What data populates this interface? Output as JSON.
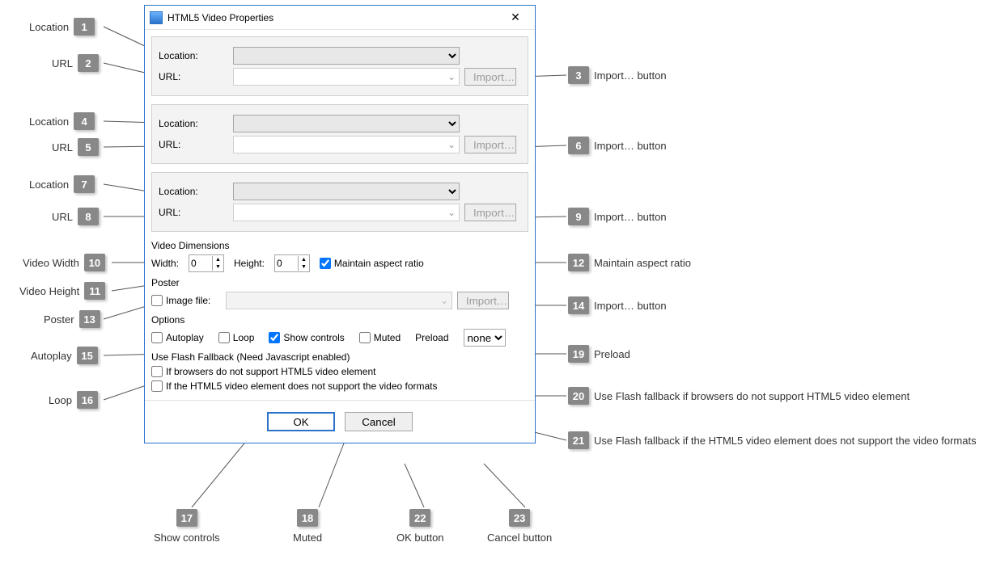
{
  "dialog": {
    "title": "HTML5 Video Properties",
    "close_icon": "✕"
  },
  "sources": [
    {
      "location_label": "Location:",
      "url_label": "URL:",
      "location_value": "",
      "url_value": "",
      "import_label": "Import…"
    },
    {
      "location_label": "Location:",
      "url_label": "URL:",
      "location_value": "",
      "url_value": "",
      "import_label": "Import…"
    },
    {
      "location_label": "Location:",
      "url_label": "URL:",
      "location_value": "",
      "url_value": "",
      "import_label": "Import…"
    }
  ],
  "dimensions": {
    "group_label": "Video Dimensions",
    "width_label": "Width:",
    "height_label": "Height:",
    "width_value": "0",
    "height_value": "0",
    "maintain_label": "Maintain aspect ratio",
    "maintain_checked": true
  },
  "poster": {
    "group_label": "Poster",
    "image_file_label": "Image file:",
    "image_file_checked": false,
    "image_file_value": "",
    "import_label": "Import…"
  },
  "options": {
    "group_label": "Options",
    "autoplay_label": "Autoplay",
    "loop_label": "Loop",
    "show_controls_label": "Show controls",
    "muted_label": "Muted",
    "preload_label": "Preload",
    "preload_value": "none",
    "autoplay": false,
    "loop": false,
    "show_controls": true,
    "muted": false
  },
  "fallback": {
    "group_label": "Use Flash Fallback (Need Javascript enabled)",
    "no_html5_label": "If browsers do not support HTML5 video element",
    "no_formats_label": "If the HTML5 video element does not support the video formats",
    "no_html5": false,
    "no_formats": false
  },
  "footer": {
    "ok_label": "OK",
    "cancel_label": "Cancel"
  },
  "callouts": {
    "1": "Location",
    "2": "URL",
    "3": "Import… button",
    "4": "Location",
    "5": "URL",
    "6": "Import… button",
    "7": "Location",
    "8": "URL",
    "9": "Import… button",
    "10": "Video Width",
    "11": "Video Height",
    "12": "Maintain aspect ratio",
    "13": "Poster",
    "14": "Import… button",
    "15": "Autoplay",
    "16": "Loop",
    "17": "Show controls",
    "18": "Muted",
    "19": "Preload",
    "20": "Use Flash fallback if browsers do not support HTML5 video element",
    "21": "Use Flash fallback if the HTML5 video element does not support the video formats",
    "22": "OK button",
    "23": "Cancel button"
  }
}
